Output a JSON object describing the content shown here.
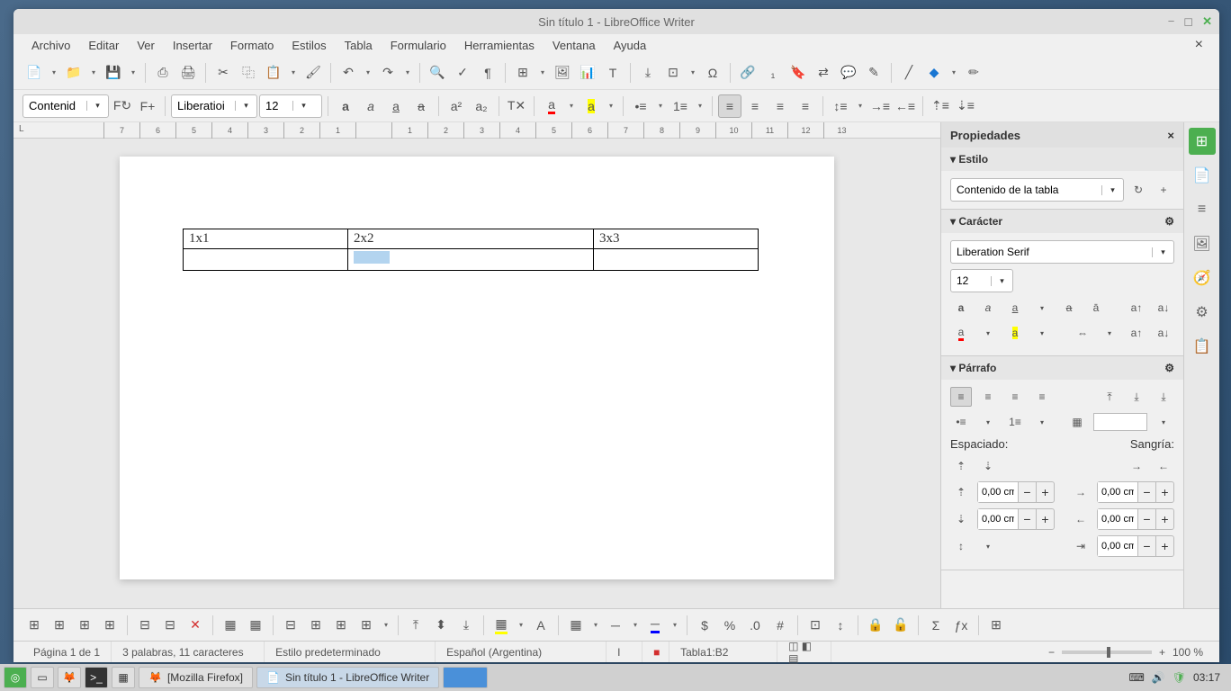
{
  "window_title": "Sin título 1 - LibreOffice Writer",
  "menu": [
    "Archivo",
    "Editar",
    "Ver",
    "Insertar",
    "Formato",
    "Estilos",
    "Tabla",
    "Formulario",
    "Herramientas",
    "Ventana",
    "Ayuda"
  ],
  "toolbar_combo": {
    "style": "Contenid",
    "font": "Liberatioi",
    "size": "12"
  },
  "ruler_marks": [
    "7",
    "6",
    "5",
    "4",
    "3",
    "2",
    "1",
    "",
    "1",
    "2",
    "3",
    "4",
    "5",
    "6",
    "7",
    "8",
    "9",
    "10",
    "11",
    "12",
    "13"
  ],
  "table": {
    "rows": [
      [
        "1x1",
        "2x2",
        "3x3"
      ],
      [
        "",
        "",
        ""
      ]
    ],
    "selected_cell": [
      1,
      1
    ]
  },
  "sidebar": {
    "title": "Propiedades",
    "style": {
      "header": "Estilo",
      "value": "Contenido de la tabla"
    },
    "character": {
      "header": "Carácter",
      "font": "Liberation Serif",
      "size": "12"
    },
    "paragraph": {
      "header": "Párrafo",
      "espaciado": "Espaciado:",
      "sangria": "Sangría:",
      "val": "0,00 cm"
    }
  },
  "status": {
    "page": "Página 1 de 1",
    "words": "3 palabras, 11 caracteres",
    "style": "Estilo predeterminado",
    "lang": "Español (Argentina)",
    "cell": "Tabla1:B2",
    "zoom": "100 %"
  },
  "taskbar": {
    "firefox": "[Mozilla Firefox]",
    "writer": "Sin título 1 - LibreOffice Writer",
    "time": "03:17"
  }
}
